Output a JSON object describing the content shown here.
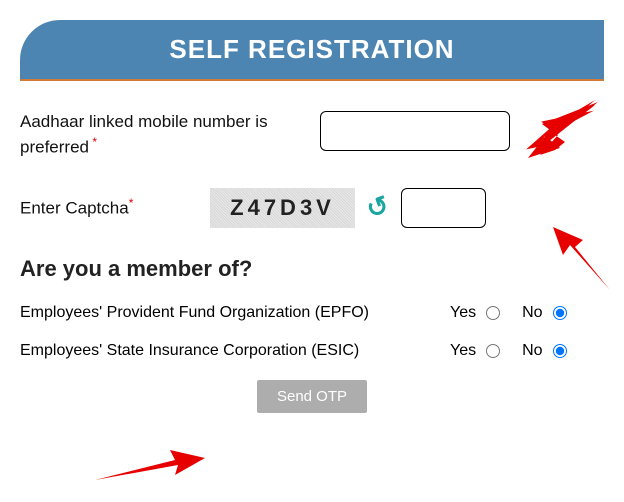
{
  "header": {
    "title": "SELF REGISTRATION"
  },
  "mobile": {
    "label": "Aadhaar linked mobile number is preferred",
    "value": ""
  },
  "captcha": {
    "label": "Enter Captcha",
    "image_text": "Z47D3V",
    "value": ""
  },
  "section": {
    "heading": "Are you a member of?"
  },
  "members": [
    {
      "label": "Employees' Provident Fund Organization (EPFO)",
      "yes": "Yes",
      "no": "No"
    },
    {
      "label": "Employees' State Insurance Corporation (ESIC)",
      "yes": "Yes",
      "no": "No"
    }
  ],
  "submit": {
    "label": "Send OTP"
  }
}
